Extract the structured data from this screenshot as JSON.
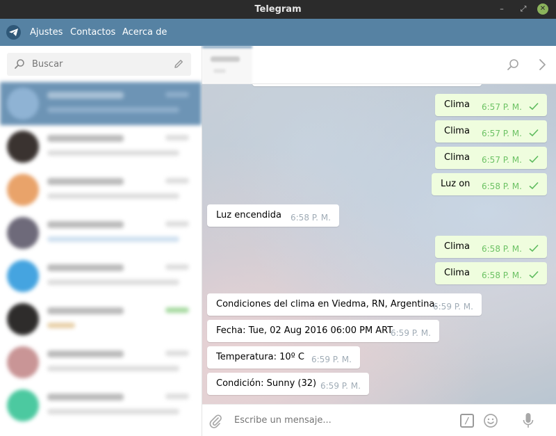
{
  "window": {
    "title": "Telegram"
  },
  "menu": {
    "items": [
      "Ajustes",
      "Contactos",
      "Acerca de"
    ]
  },
  "sidebar": {
    "search_placeholder": "Buscar"
  },
  "compose": {
    "placeholder": "Escribe un mensaje...",
    "command_symbol": "/"
  },
  "colors": {
    "menu_bar": "#5682a3",
    "outgoing_bubble": "#effdde",
    "time_outgoing": "#6cc264",
    "accent": "#6d94b5"
  },
  "icons": {
    "menu": "telegram-logo-icon",
    "search": "search-icon",
    "compose_new": "pencil-icon",
    "header_search": "search-icon",
    "header_more": "chevron-right-icon",
    "attach": "paperclip-icon",
    "emoji": "smiley-icon",
    "voice": "microphone-icon",
    "read_receipt": "checkmark-icon"
  },
  "messages": [
    {
      "direction": "out",
      "text": "Clima",
      "time": "6:57 P. M.",
      "read": true
    },
    {
      "direction": "out",
      "text": "Clima",
      "time": "6:57 P. M.",
      "read": true
    },
    {
      "direction": "out",
      "text": "Clima",
      "time": "6:57 P. M.",
      "read": true
    },
    {
      "direction": "out",
      "text": "Luz on",
      "time": "6:58 P. M.",
      "read": true
    },
    {
      "direction": "in",
      "text": "Luz encendida",
      "time": "6:58 P. M."
    },
    {
      "direction": "out",
      "text": "Clima",
      "time": "6:58 P. M.",
      "read": true
    },
    {
      "direction": "out",
      "text": "Clima",
      "time": "6:58 P. M.",
      "read": true
    },
    {
      "direction": "in",
      "text": "Condiciones del clima en Viedma, RN, Argentina.",
      "time": "6:59 P. M."
    },
    {
      "direction": "in",
      "text": "Fecha: Tue, 02 Aug 2016 06:00 PM ART",
      "time": "6:59 P. M."
    },
    {
      "direction": "in",
      "text": "Temperatura: 10º C",
      "time": "6:59 P. M."
    },
    {
      "direction": "in",
      "text": "Condición: Sunny (32)",
      "time": "6:59 P. M."
    }
  ]
}
